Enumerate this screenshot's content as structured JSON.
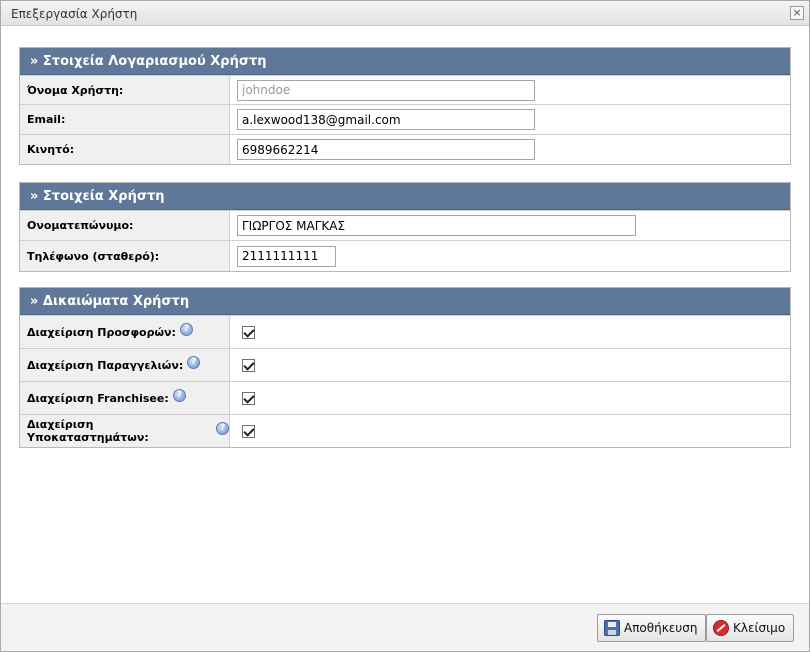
{
  "window": {
    "title": "Επεξεργασία Χρήστη",
    "close_symbol": "×"
  },
  "account_section": {
    "header": "» Στοιχεία Λογαριασμού Χρήστη",
    "fields": [
      {
        "label": "Όνομα Χρήστη:",
        "value": "johndoe",
        "disabled": true
      },
      {
        "label": "Email:",
        "value": "a.lexwood138@gmail.com"
      },
      {
        "label": "Κινητό:",
        "value": "6989662214"
      }
    ]
  },
  "user_section": {
    "header": "» Στοιχεία Χρήστη",
    "fields": [
      {
        "label": "Ονοματεπώνυμο:",
        "value": "ΓΙΩΡΓΟΣ ΜΑΓΚΑΣ"
      },
      {
        "label": "Τηλέφωνο (σταθερό):",
        "value": "2111111111"
      }
    ]
  },
  "permissions_section": {
    "header": "» Δικαιώματα Χρήστη",
    "items": [
      {
        "label": "Διαχείριση Προσφορών:",
        "checked": true
      },
      {
        "label": "Διαχείριση Παραγγελιών:",
        "checked": true
      },
      {
        "label": "Διαχείριση Franchisee:",
        "checked": true
      },
      {
        "label": "Διαχείριση Υποκαταστημάτων:",
        "checked": true
      }
    ],
    "help_symbol": "?"
  },
  "footer": {
    "save_label": "Αποθήκευση",
    "close_label": "Κλείσιμο"
  },
  "icons": {
    "save": "floppy-disk-icon",
    "close": "cancel-icon",
    "help": "help-icon"
  }
}
